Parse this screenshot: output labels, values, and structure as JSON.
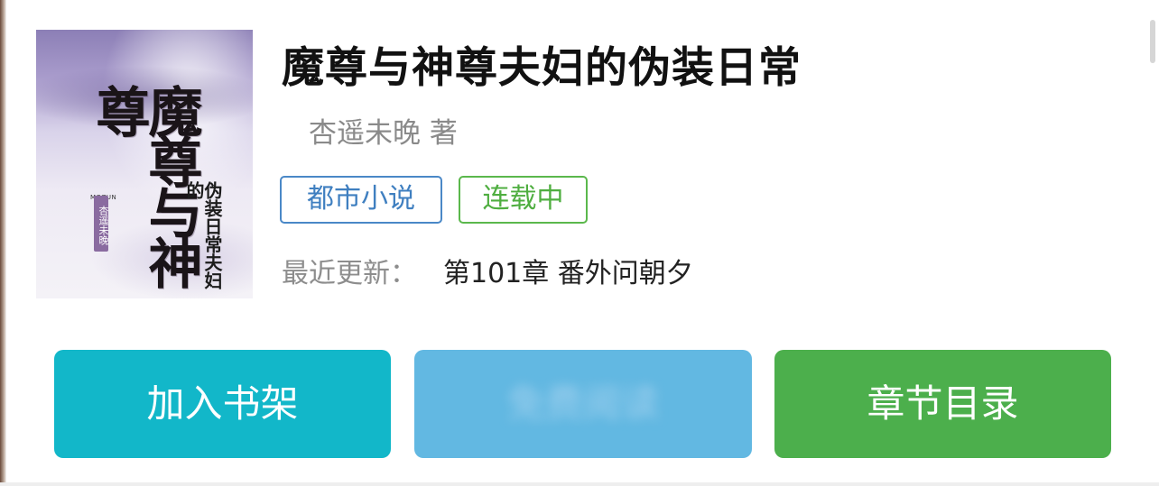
{
  "book": {
    "title": "魔尊与神尊夫妇的伪装日常",
    "author": "杏遥未晚 著",
    "tags": {
      "genre": "都市小说",
      "status": "连载中"
    },
    "latest_update_label": "最近更新：",
    "latest_chapter": "第101章 番外问朝夕"
  },
  "cover": {
    "title_text": "魔尊与神尊",
    "subtitle_text": "伪装日常夫妇的",
    "seal_text": "杏遥未晚",
    "small_text": "MOZUN"
  },
  "actions": {
    "add_to_shelf": "加入书架",
    "read": "免费阅读",
    "table_of_contents": "章节目录"
  },
  "colors": {
    "shelf_button": "#12b7c9",
    "read_button": "#62b8e2",
    "toc_button": "#4caf4c",
    "genre_tag": "#4a88c7",
    "status_tag": "#5bb84c"
  },
  "icons": {
    "cover": "book-cover-image"
  }
}
